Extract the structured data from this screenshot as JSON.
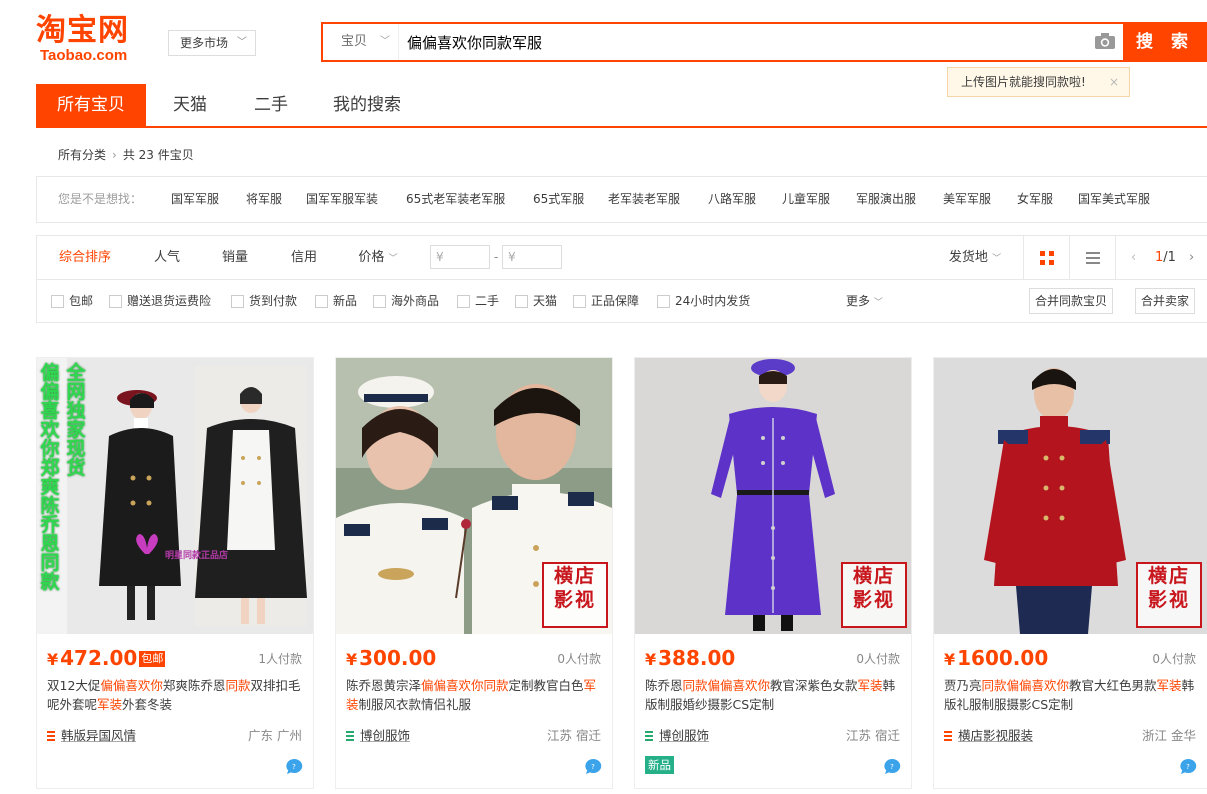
{
  "header": {
    "logo_cn": "淘宝网",
    "logo_en": "Taobao.com",
    "market_label": "更多市场",
    "search_scope": "宝贝",
    "search_query": "偏偏喜欢你同款军服",
    "search_button": "搜 索",
    "image_search_tip": "上传图片就能搜同款啦!",
    "tip_close": "×"
  },
  "tabs": [
    "所有宝贝",
    "天猫",
    "二手",
    "我的搜索"
  ],
  "breadcrumb": {
    "all": "所有分类",
    "count_text": "共 23 件宝贝"
  },
  "suggestions": {
    "label": "您是不是想找：",
    "items": [
      "国军军服",
      "将军服",
      "国军军服军装",
      "65式老军装老军服",
      "65式军服",
      "老军装老军服",
      "八路军服",
      "儿童军服",
      "军服演出服",
      "美军军服",
      "女军服",
      "国军美式军服"
    ]
  },
  "sortbar": {
    "items": [
      "综合排序",
      "人气",
      "销量",
      "信用",
      "价格"
    ],
    "price_placeholder": "¥",
    "dash": "-",
    "ship_from": "发货地",
    "page_current": "1",
    "page_total": "/1"
  },
  "filters": {
    "items": [
      "包邮",
      "赠送退货运费险",
      "货到付款",
      "新品",
      "海外商品",
      "二手",
      "天猫",
      "正品保障",
      "24小时内发货"
    ],
    "more": "更多",
    "merge_same": "合并同款宝贝",
    "merge_seller": "合并卖家"
  },
  "products": [
    {
      "price": "472.00",
      "yen": "¥",
      "baoyou": "包邮",
      "deals": "1人付款",
      "title_parts": [
        "双12大促",
        "偏偏喜欢你",
        "郑爽陈乔恩",
        "同款",
        "双排扣毛呢外套呢",
        "军装",
        "外套冬装"
      ],
      "shop": "韩版异国风情",
      "location": "广东 广州",
      "overlay_text_left": "偏偏喜欢你郑爽陈乔恩同款",
      "overlay_text_right": "全网独家现货",
      "watermark": "明星同款正品店"
    },
    {
      "price": "300.00",
      "yen": "¥",
      "deals": "0人付款",
      "title_parts": [
        "陈乔恩黄宗泽",
        "偏偏喜欢你同款",
        "定制教官白色",
        "军装",
        "制服风衣款情侣礼服"
      ],
      "shop": "博创服饰",
      "location": "江苏 宿迁",
      "stamp_top": "横店",
      "stamp_bottom": "影视"
    },
    {
      "price": "388.00",
      "yen": "¥",
      "deals": "0人付款",
      "title_parts": [
        "陈乔恩",
        "同款偏偏喜欢你",
        "教官深紫色女款",
        "军装",
        "韩版制服婚纱摄影CS定制"
      ],
      "shop": "博创服饰",
      "location": "江苏 宿迁",
      "badge": "新品",
      "stamp_top": "横店",
      "stamp_bottom": "影视"
    },
    {
      "price": "1600.00",
      "yen": "¥",
      "deals": "0人付款",
      "title_parts": [
        "贾乃亮",
        "同款偏偏喜欢你",
        "教官大红色男款",
        "军装",
        "韩版礼服制服摄影CS定制"
      ],
      "shop": "横店影视服装",
      "location": "浙江 金华",
      "stamp_top": "横店",
      "stamp_bottom": "影视"
    }
  ],
  "colors": {
    "accent": "#ff4400",
    "stamp_red": "#c8161d",
    "new_badge": "#26b08a"
  }
}
